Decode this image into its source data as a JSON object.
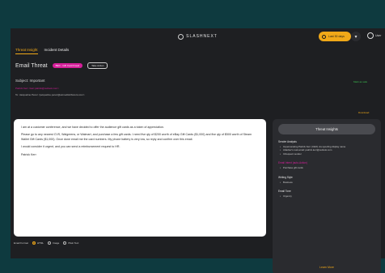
{
  "app": {
    "logo_text": "SLASHNEXT",
    "timer_label": "Last 30 days",
    "user_label": "User"
  },
  "tabs": [
    {
      "label": "Threat Insight",
      "active": true
    },
    {
      "label": "Incident Details",
      "active": false
    }
  ],
  "email": {
    "header_title": "Email Threat",
    "status_badge": "BEC - Gift Card Fraud",
    "secondary_badge": "Take Action",
    "subject_label": "Subject: Important",
    "from_line": "Patrick Kerr <kerr.patrick@outlook.com>",
    "to_line": "To: Jacqueline Perez <jacqueline.perez@acmedistributors.com>",
    "mark_safe_label": "Mark as safe",
    "download_label": "Download",
    "body_paragraphs": [
      "I am at a customer conference, and we have decided to offer the audience gift cards as a token of appreciation.",
      "Please go to any nearest CVS, Walgreens, or Walmart, and purchase a few gift cards. I need five qty of $200 worth of eBay Gift Cards ($1,000) and five qty of $500 worth of Steam Wallet Gift Cards ($1,000). Once done email me the card numbers. My phone battery is very low, so reply and confirm over this email.",
      "I would consider it urgent, and you can send a reimbursement request to HR.",
      "Patrick Kerr"
    ],
    "format_label": "Email Format",
    "format_options": [
      {
        "label": "HTML",
        "selected": true
      },
      {
        "label": "Image",
        "selected": false
      },
      {
        "label": "Plain Text",
        "selected": false
      }
    ]
  },
  "insights": {
    "button_label": "Threat Insights",
    "sections": [
      {
        "title": "Sender Analysis",
        "red": false,
        "items": [
          "Impersonating Patrick Kerr (CEO) via spoofing display name",
          "Attacker's real email: patrick.kerr@outlook.com",
          "Infrequent sender"
        ]
      },
      {
        "title": "Email Intent (auto-Action)",
        "red": true,
        "items": [
          "Purchase gift cards"
        ]
      },
      {
        "title": "Writing Style",
        "red": false,
        "items": [
          "Business"
        ]
      },
      {
        "title": "Email Tone",
        "red": false,
        "items": [
          "Urgency"
        ]
      }
    ],
    "learn_more_label": "Learn More"
  },
  "colors": {
    "accent_orange": "#f0a818",
    "threat_magenta": "#d61f9a",
    "safe_green": "#3bbf4f",
    "outer_bg": "#0e3a3f",
    "panel_bg": "#1e1f22"
  }
}
